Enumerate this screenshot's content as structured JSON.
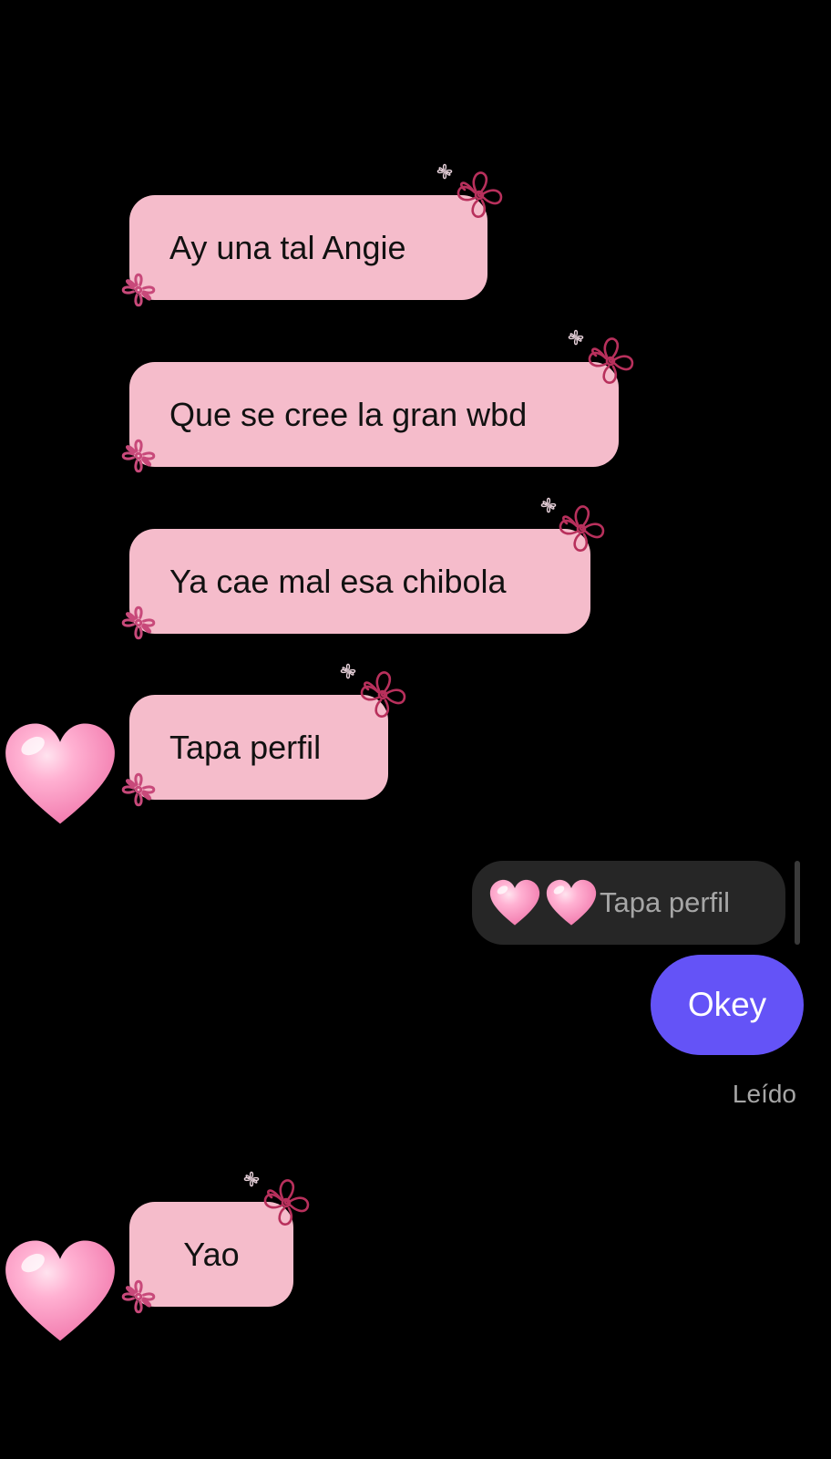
{
  "conversation": {
    "received": [
      {
        "text": "Ay una tal Angie"
      },
      {
        "text": "Que se cree la gran wbd"
      },
      {
        "text": "Ya cae mal esa chibola"
      },
      {
        "text": "Tapa perfil"
      },
      {
        "text": "Yao"
      }
    ],
    "reply_quote": {
      "text": "Tapa perfil"
    },
    "sent": {
      "text": "Okey",
      "status": "Leído"
    }
  },
  "colors": {
    "background": "#000000",
    "received_bubble": "#f5bccb",
    "sent_bubble": "#6453f7",
    "flower_outline": "#b8305c",
    "heart_pink": "#ff9fc8"
  },
  "icons": [
    "pink-heart-icon",
    "flower-doodle-icon",
    "small-flower-icon"
  ]
}
